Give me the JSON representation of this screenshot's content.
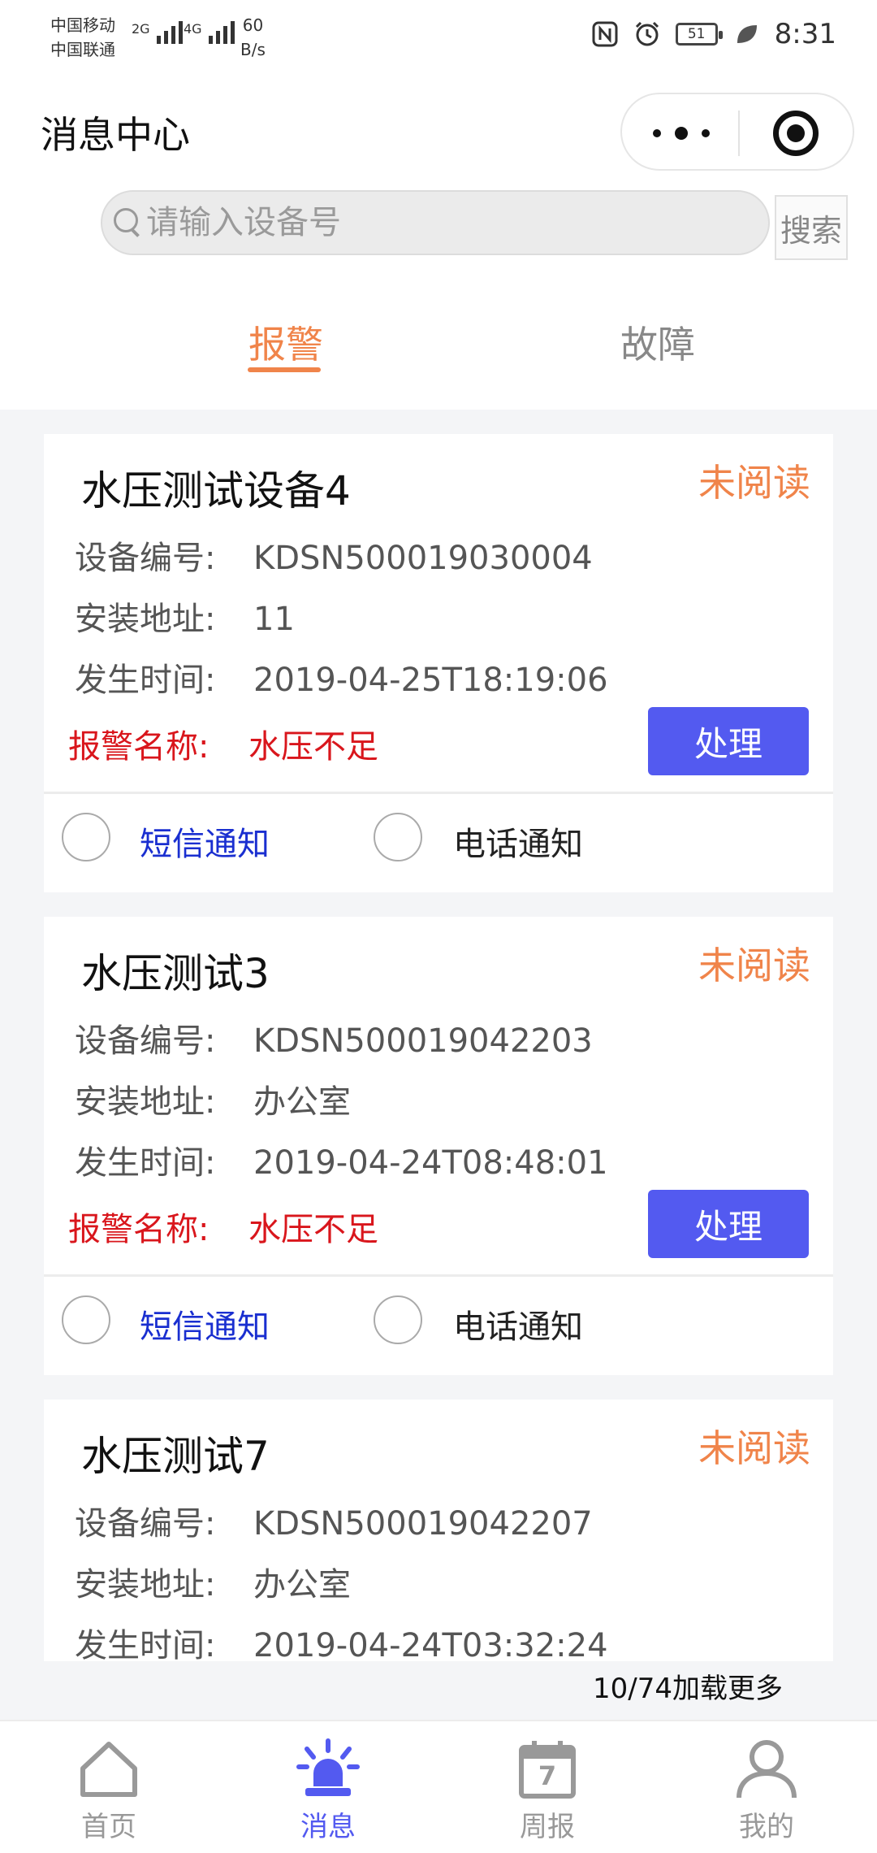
{
  "status_bar": {
    "carrier1": "中国移动",
    "carrier2": "中国联通",
    "sig1_label": "2G",
    "sig2_label": "4G",
    "speed_value": "60",
    "speed_unit": "B/s",
    "battery": "51",
    "time": "8:31"
  },
  "header": {
    "title": "消息中心"
  },
  "search": {
    "placeholder": "请输入设备号",
    "button_label": "搜索"
  },
  "tabs": [
    {
      "label": "报警",
      "active": true
    },
    {
      "label": "故障",
      "active": false
    }
  ],
  "cards": [
    {
      "title": "水压测试设备4",
      "status": "未阅读",
      "fields": {
        "device_no_label": "设备编号:",
        "device_no": "KDSN500019030004",
        "address_label": "安装地址:",
        "address": "11",
        "time_label": "发生时间:",
        "time": "2019-04-25T18:19:06",
        "alarm_label": "报警名称:",
        "alarm": "水压不足"
      },
      "action_label": "处理",
      "notify_sms": "短信通知",
      "notify_phone": "电话通知"
    },
    {
      "title": "水压测试3",
      "status": "未阅读",
      "fields": {
        "device_no_label": "设备编号:",
        "device_no": "KDSN500019042203",
        "address_label": "安装地址:",
        "address": "办公室",
        "time_label": "发生时间:",
        "time": "2019-04-24T08:48:01",
        "alarm_label": "报警名称:",
        "alarm": "水压不足"
      },
      "action_label": "处理",
      "notify_sms": "短信通知",
      "notify_phone": "电话通知"
    },
    {
      "title": "水压测试7",
      "status": "未阅读",
      "fields": {
        "device_no_label": "设备编号:",
        "device_no": "KDSN500019042207",
        "address_label": "安装地址:",
        "address": "办公室",
        "time_label": "发生时间:",
        "time": "2019-04-24T03:32:24"
      }
    }
  ],
  "load_more": "10/74加载更多",
  "bottom_nav": [
    {
      "label": "首页",
      "icon": "home-icon",
      "active": false
    },
    {
      "label": "消息",
      "icon": "alarm-light-icon",
      "active": true
    },
    {
      "label": "周报",
      "icon": "calendar-icon",
      "active": false,
      "badge": "7"
    },
    {
      "label": "我的",
      "icon": "user-icon",
      "active": false
    }
  ],
  "colors": {
    "accent_orange": "#f0844a",
    "alarm_red": "#d9161c",
    "button_blue": "#535af0",
    "link_blue": "#1a2fd0"
  }
}
